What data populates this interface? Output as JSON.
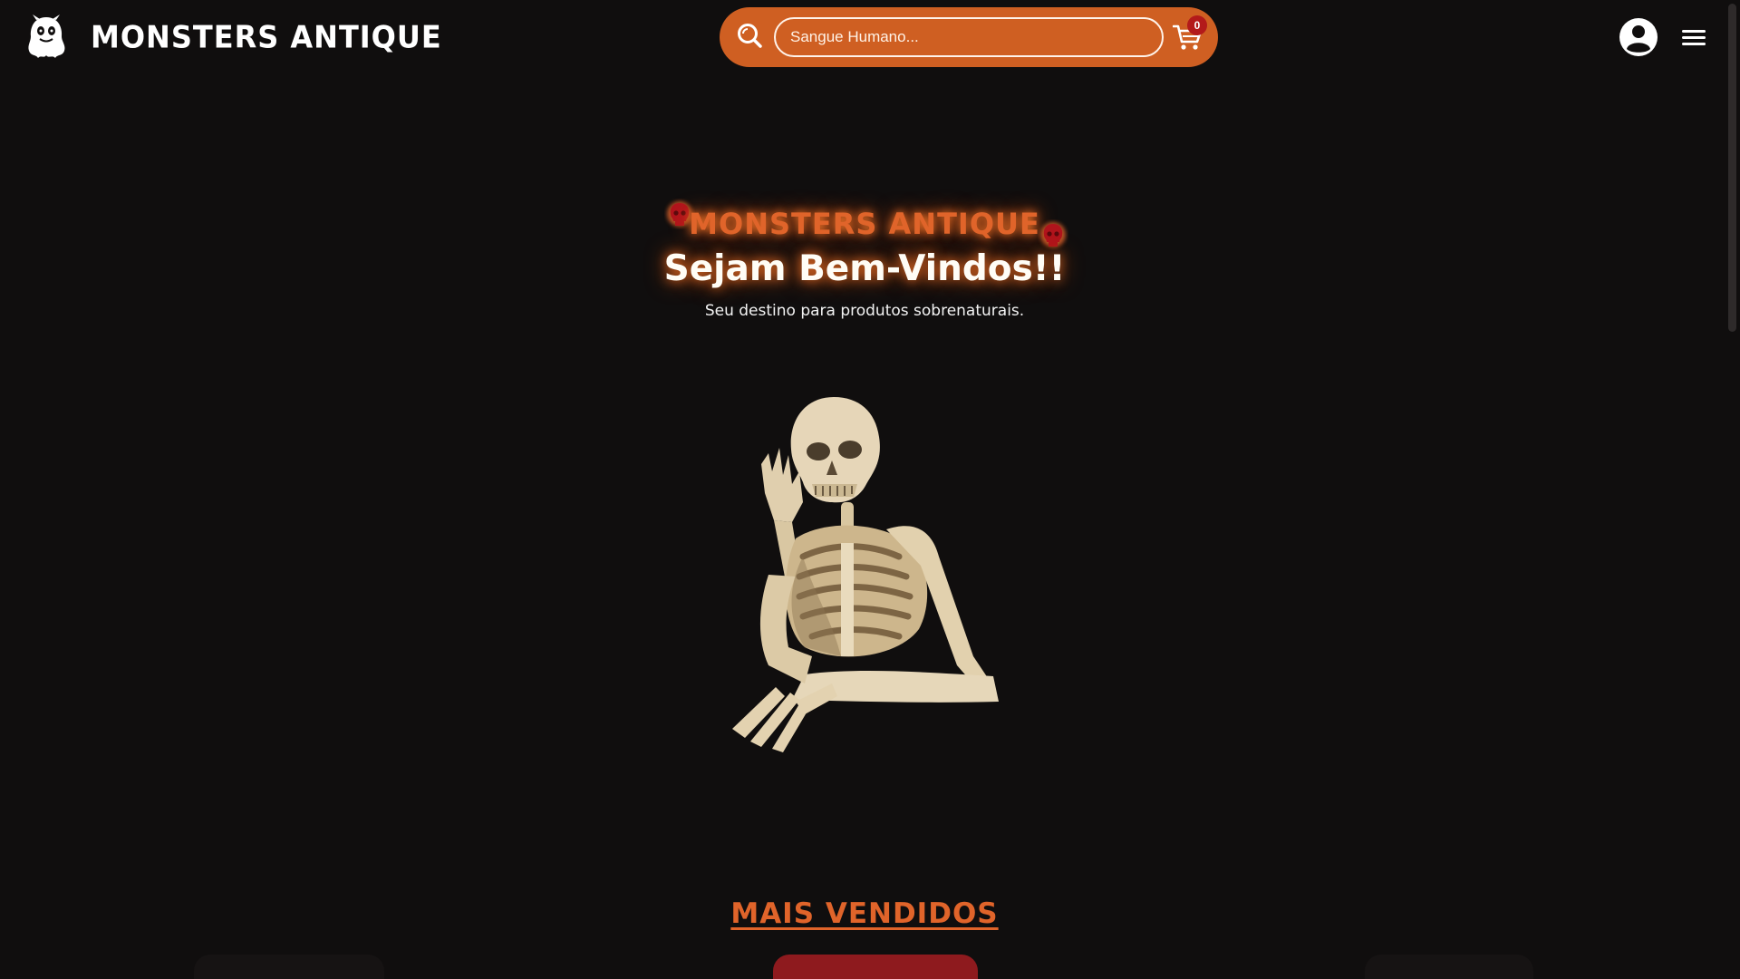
{
  "header": {
    "brand_name": "MONSTERS ANTIQUE",
    "search_placeholder": "Sangue Humano...",
    "cart_count": "0"
  },
  "hero": {
    "brand": "MONSTERS ANTIQUE",
    "title": "Sejam Bem-Vindos!!",
    "subtitle": "Seu destino para produtos sobrenaturais."
  },
  "best_sellers": {
    "title": "MAIS VENDIDOS"
  },
  "colors": {
    "background": "#100e0e",
    "accent": "#cf5f22",
    "glow": "#e0642a",
    "badge": "#b31a1a"
  },
  "icons": [
    "ghost-logo-icon",
    "search-icon",
    "cart-icon",
    "user-icon",
    "menu-icon",
    "skull-icon",
    "skeleton-image"
  ]
}
